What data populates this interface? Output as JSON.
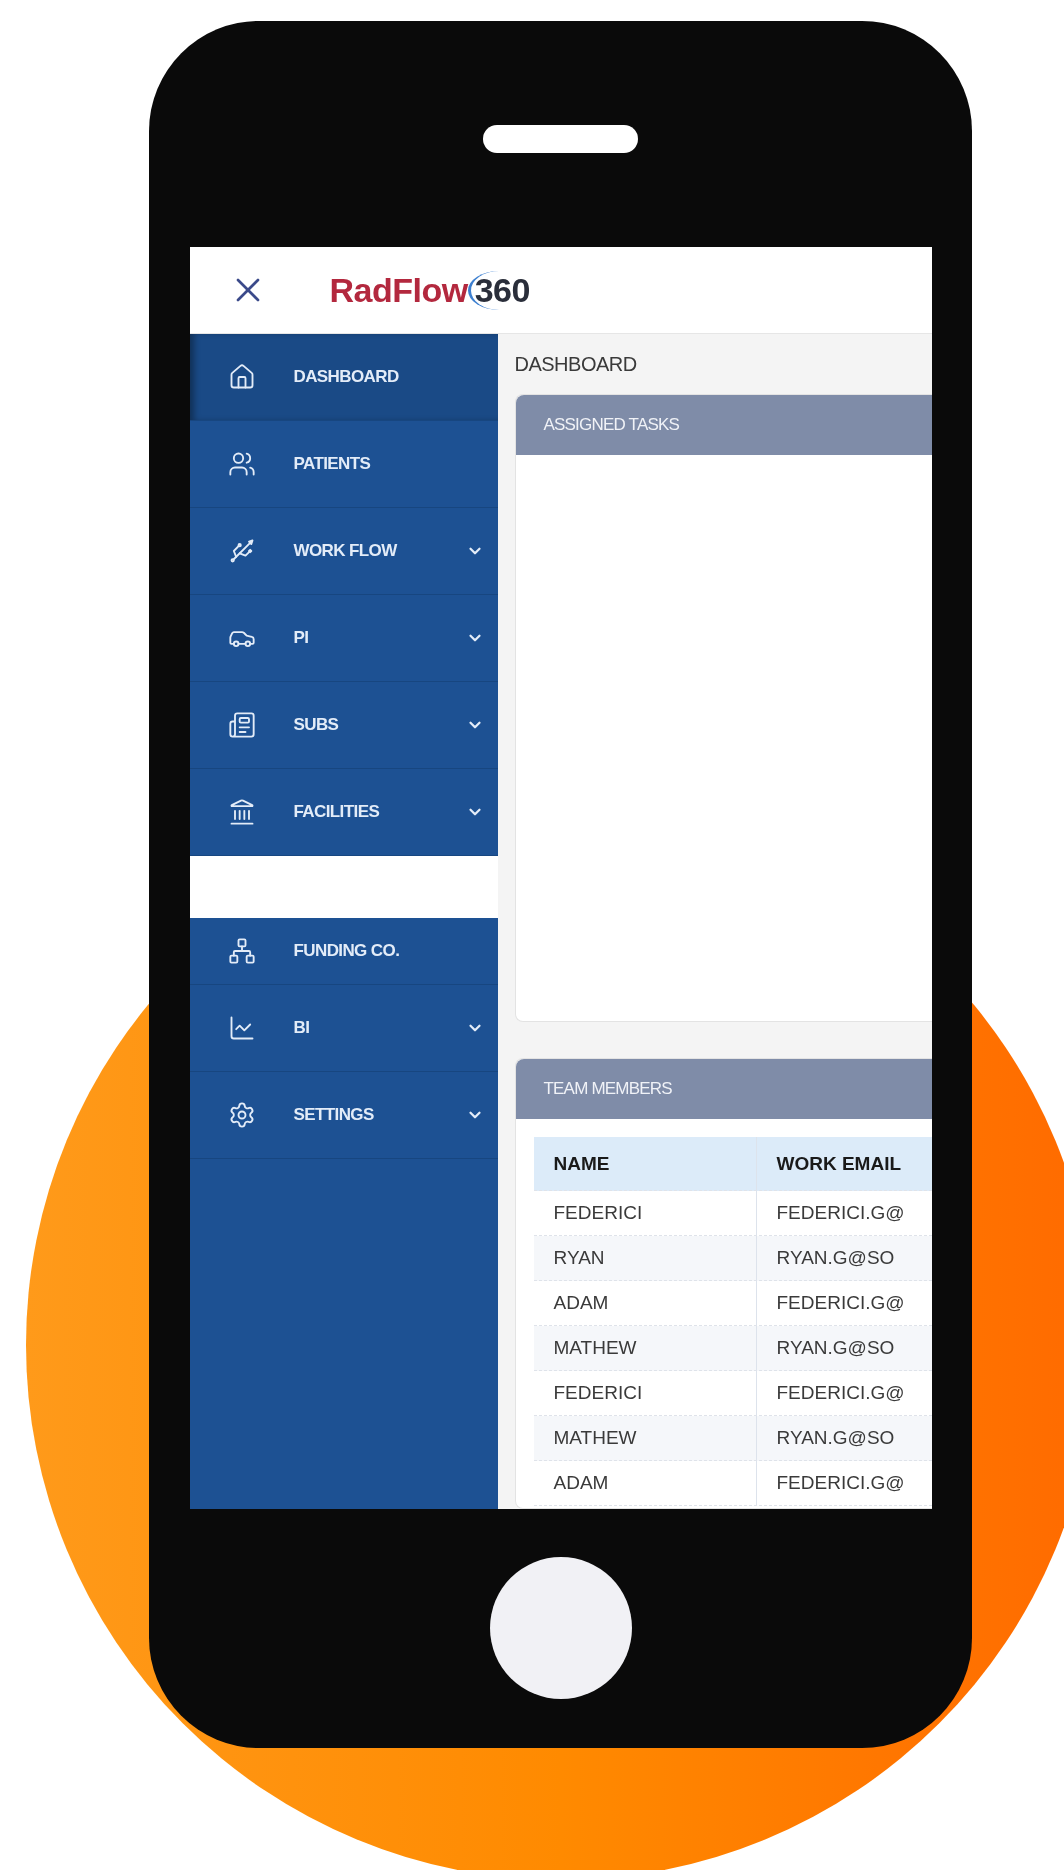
{
  "header": {
    "logo_word": "RadFlow",
    "logo_number": "360"
  },
  "sidebar": {
    "groups": [
      {
        "items": [
          {
            "label": "DASHBOARD",
            "selected": true,
            "expandable": false
          },
          {
            "label": "PATIENTS",
            "selected": false,
            "expandable": false
          },
          {
            "label": "WORK FLOW",
            "selected": false,
            "expandable": true
          },
          {
            "label": "PI",
            "selected": false,
            "expandable": true
          },
          {
            "label": "SUBS",
            "selected": false,
            "expandable": true
          },
          {
            "label": "FACILITIES",
            "selected": false,
            "expandable": true
          }
        ]
      },
      {
        "items": [
          {
            "label": "FUNDING CO.",
            "selected": false,
            "expandable": false
          },
          {
            "label": "BI",
            "selected": false,
            "expandable": true
          },
          {
            "label": "SETTINGS",
            "selected": false,
            "expandable": true
          }
        ]
      }
    ]
  },
  "main": {
    "breadcrumb": "DASHBOARD",
    "assigned_tasks": {
      "title": "ASSIGNED TASKS"
    },
    "team_members": {
      "title": "TEAM MEMBERS",
      "columns": [
        "NAME",
        "WORK EMAIL"
      ],
      "rows": [
        [
          "FEDERICI",
          "FEDERICI.G@"
        ],
        [
          "RYAN",
          "RYAN.G@SO"
        ],
        [
          "ADAM",
          "FEDERICI.G@"
        ],
        [
          "MATHEW",
          "RYAN.G@SO"
        ],
        [
          "FEDERICI",
          "FEDERICI.G@"
        ],
        [
          "MATHEW",
          "RYAN.G@SO"
        ],
        [
          "ADAM",
          "FEDERICI.G@"
        ]
      ]
    }
  }
}
